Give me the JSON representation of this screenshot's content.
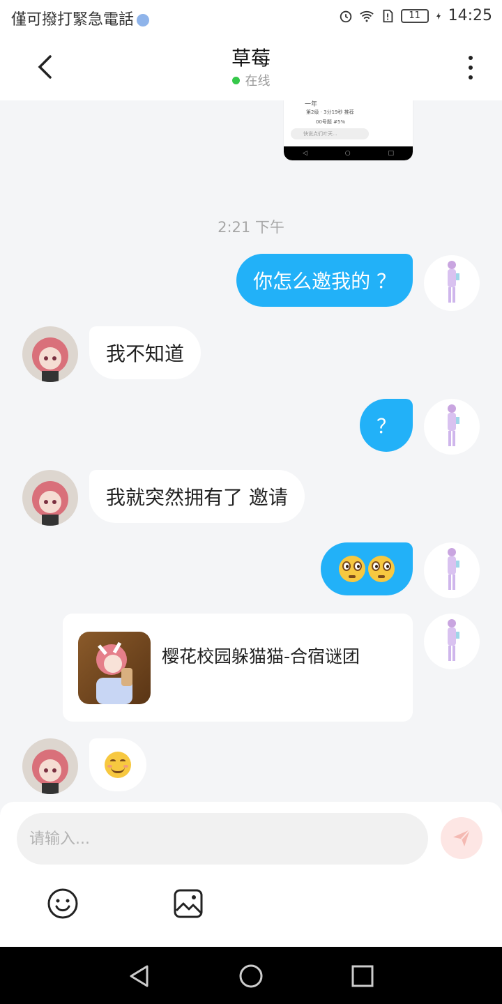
{
  "status_bar": {
    "carrier": "僅可撥打緊急電話",
    "battery": "11",
    "time": "14:25"
  },
  "header": {
    "title": "草莓",
    "online_status": "在线"
  },
  "screenshot_preview": {
    "line1": "一年",
    "line2": "第2级 · 3分19秒 推荐",
    "line3": "00号题 #5%",
    "input_hint": "快说点们叶天..."
  },
  "chat": {
    "timestamp": "2:21 下午",
    "messages": [
      {
        "from": "me",
        "text": "你怎么邀我的 ？"
      },
      {
        "from": "them",
        "text": "我不知道"
      },
      {
        "from": "me",
        "text": "？"
      },
      {
        "from": "them",
        "text": "我就突然拥有了 邀请"
      },
      {
        "from": "me",
        "emoji": "flushed-face x2"
      },
      {
        "from": "me",
        "share_title": "樱花校园躲猫猫-合宿谜团"
      },
      {
        "from": "them",
        "emoji": "smiling-face"
      }
    ]
  },
  "input": {
    "placeholder": "请输入..."
  },
  "colors": {
    "my_bubble": "#22b1f8",
    "their_bubble": "#ffffff",
    "background": "#f4f5f7",
    "online": "#35c84a",
    "send_button": "#fde6e4"
  }
}
